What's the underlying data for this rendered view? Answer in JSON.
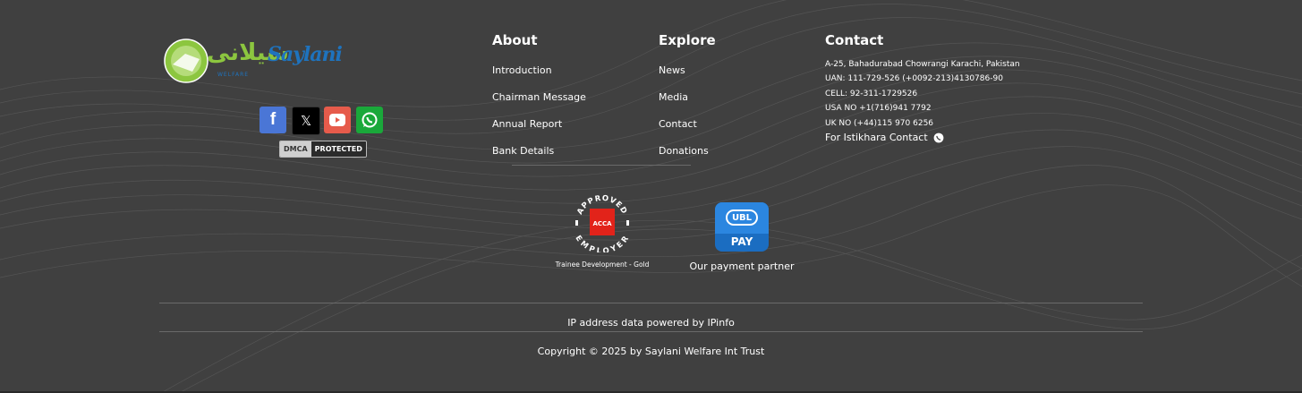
{
  "brand": {
    "logo_urdu": "سیلانی",
    "logo_english": "Saylani",
    "logo_sub": "WELFARE"
  },
  "social": [
    {
      "name": "facebook",
      "icon": "facebook-icon",
      "color": "#4a76d6",
      "glyph": "f"
    },
    {
      "name": "x",
      "icon": "x-icon",
      "color": "#000000",
      "glyph": "𝕏"
    },
    {
      "name": "youtube",
      "icon": "youtube-icon",
      "color": "#e65b4b",
      "glyph": "▶"
    },
    {
      "name": "whatsapp",
      "icon": "whatsapp-icon",
      "color": "#1aa83a",
      "glyph": "✆"
    }
  ],
  "dmca": {
    "left": "DMCA",
    "right": "PROTECTED"
  },
  "about": {
    "title": "About",
    "links": [
      "Introduction",
      "Chairman Message",
      "Annual Report",
      "Bank Details"
    ]
  },
  "explore": {
    "title": "Explore",
    "links": [
      "News",
      "Media",
      "Contact",
      "Donations"
    ]
  },
  "contact": {
    "title": "Contact",
    "address": "A-25, Bahadurabad Chowrangi Karachi, Pakistan",
    "uan": "UAN: 111-729-526 (+0092-213)4130786-90",
    "cell": "CELL: 92-311-1729526",
    "usa": "USA NO +1(716)941 7792",
    "uk": "UK NO (+44)115 970 6256",
    "istikhara": "For Istikhara Contact"
  },
  "acca": {
    "top_arc": "APPROVED",
    "bottom_arc": "EMPLOYER",
    "box": "ACCA",
    "caption": "Trainee Development - Gold"
  },
  "ubl": {
    "top": "UBL",
    "bottom": "PAY",
    "caption": "Our payment partner"
  },
  "footer": {
    "ip_text": "IP address data powered by IPinfo",
    "copyright": "Copyright © 2025 by Saylani Welfare Int Trust"
  },
  "colors": {
    "background": "#404040",
    "logo_green": "#8cc63f",
    "logo_blue": "#1e73be",
    "acca_red": "#e2231a",
    "ubl_blue": "#1b6dc1"
  }
}
